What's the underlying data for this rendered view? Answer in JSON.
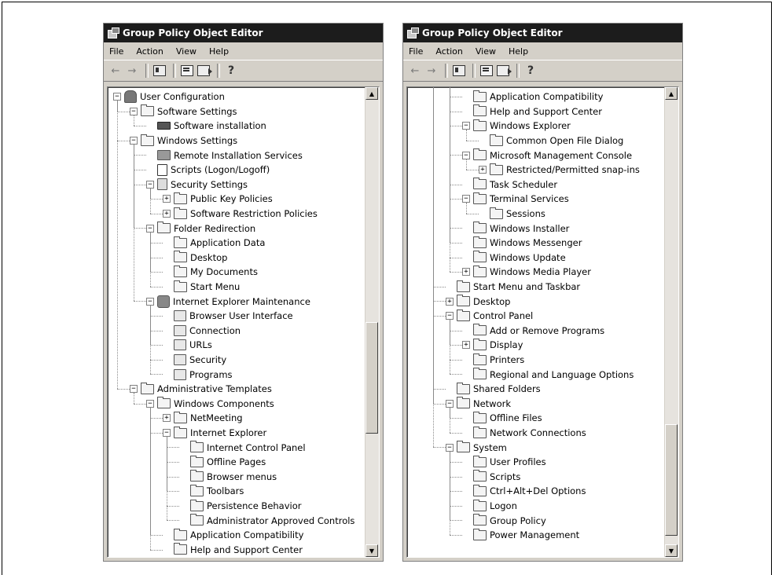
{
  "windows": [
    {
      "title": "Group Policy Object Editor",
      "menu": [
        "File",
        "Action",
        "View",
        "Help"
      ],
      "tree": [
        {
          "label": "User Configuration",
          "level": 0,
          "expander": "minus",
          "icon": "user"
        },
        {
          "label": "Software Settings",
          "level": 1,
          "expander": "minus",
          "icon": "folder"
        },
        {
          "label": "Software installation",
          "level": 2,
          "expander": "none",
          "icon": "drive"
        },
        {
          "label": "Windows Settings",
          "level": 1,
          "expander": "minus",
          "icon": "folder"
        },
        {
          "label": "Remote Installation Services",
          "level": 2,
          "expander": "none",
          "icon": "ris"
        },
        {
          "label": "Scripts (Logon/Logoff)",
          "level": 2,
          "expander": "none",
          "icon": "script"
        },
        {
          "label": "Security Settings",
          "level": 2,
          "expander": "minus",
          "icon": "security"
        },
        {
          "label": "Public Key Policies",
          "level": 3,
          "expander": "plus",
          "icon": "folder"
        },
        {
          "label": "Software Restriction Policies",
          "level": 3,
          "expander": "plus",
          "icon": "folder"
        },
        {
          "label": "Folder Redirection",
          "level": 2,
          "expander": "minus",
          "icon": "folder"
        },
        {
          "label": "Application Data",
          "level": 3,
          "expander": "none",
          "icon": "folder"
        },
        {
          "label": "Desktop",
          "level": 3,
          "expander": "none",
          "icon": "folder"
        },
        {
          "label": "My Documents",
          "level": 3,
          "expander": "none",
          "icon": "folder"
        },
        {
          "label": "Start Menu",
          "level": 3,
          "expander": "none",
          "icon": "folder"
        },
        {
          "label": "Internet Explorer Maintenance",
          "level": 2,
          "expander": "minus",
          "icon": "iem"
        },
        {
          "label": "Browser User Interface",
          "level": 3,
          "expander": "none",
          "icon": "iepage"
        },
        {
          "label": "Connection",
          "level": 3,
          "expander": "none",
          "icon": "iepage"
        },
        {
          "label": "URLs",
          "level": 3,
          "expander": "none",
          "icon": "iepage"
        },
        {
          "label": "Security",
          "level": 3,
          "expander": "none",
          "icon": "iepage"
        },
        {
          "label": "Programs",
          "level": 3,
          "expander": "none",
          "icon": "iepage"
        },
        {
          "label": "Administrative Templates",
          "level": 1,
          "expander": "minus",
          "icon": "folder"
        },
        {
          "label": "Windows Components",
          "level": 2,
          "expander": "minus",
          "icon": "folder"
        },
        {
          "label": "NetMeeting",
          "level": 3,
          "expander": "plus",
          "icon": "folder"
        },
        {
          "label": "Internet Explorer",
          "level": 3,
          "expander": "minus",
          "icon": "folder"
        },
        {
          "label": "Internet Control Panel",
          "level": 4,
          "expander": "none",
          "icon": "folder"
        },
        {
          "label": "Offline Pages",
          "level": 4,
          "expander": "none",
          "icon": "folder"
        },
        {
          "label": "Browser menus",
          "level": 4,
          "expander": "none",
          "icon": "folder"
        },
        {
          "label": "Toolbars",
          "level": 4,
          "expander": "none",
          "icon": "folder"
        },
        {
          "label": "Persistence Behavior",
          "level": 4,
          "expander": "none",
          "icon": "folder"
        },
        {
          "label": "Administrator Approved Controls",
          "level": 4,
          "expander": "none",
          "icon": "folder"
        },
        {
          "label": "Application Compatibility",
          "level": 3,
          "expander": "none",
          "icon": "folder"
        },
        {
          "label": "Help and Support Center",
          "level": 3,
          "expander": "none",
          "icon": "folder"
        }
      ],
      "scroll": {
        "thumb_start": 0.5,
        "thumb_size": 0.25
      }
    },
    {
      "title": "Group Policy Object Editor",
      "menu": [
        "File",
        "Action",
        "View",
        "Help"
      ],
      "tree": [
        {
          "label": "Application Compatibility",
          "level": 3,
          "expander": "none",
          "icon": "folder"
        },
        {
          "label": "Help and Support Center",
          "level": 3,
          "expander": "none",
          "icon": "folder"
        },
        {
          "label": "Windows Explorer",
          "level": 3,
          "expander": "minus",
          "icon": "folder"
        },
        {
          "label": "Common Open File Dialog",
          "level": 4,
          "expander": "none",
          "icon": "folder"
        },
        {
          "label": "Microsoft Management Console",
          "level": 3,
          "expander": "minus",
          "icon": "folder"
        },
        {
          "label": "Restricted/Permitted snap-ins",
          "level": 4,
          "expander": "plus",
          "icon": "folder"
        },
        {
          "label": "Task Scheduler",
          "level": 3,
          "expander": "none",
          "icon": "folder"
        },
        {
          "label": "Terminal Services",
          "level": 3,
          "expander": "minus",
          "icon": "folder"
        },
        {
          "label": "Sessions",
          "level": 4,
          "expander": "none",
          "icon": "folder"
        },
        {
          "label": "Windows Installer",
          "level": 3,
          "expander": "none",
          "icon": "folder"
        },
        {
          "label": "Windows Messenger",
          "level": 3,
          "expander": "none",
          "icon": "folder"
        },
        {
          "label": "Windows Update",
          "level": 3,
          "expander": "none",
          "icon": "folder"
        },
        {
          "label": "Windows Media Player",
          "level": 3,
          "expander": "plus",
          "icon": "folder"
        },
        {
          "label": "Start Menu and Taskbar",
          "level": 2,
          "expander": "none",
          "icon": "folder"
        },
        {
          "label": "Desktop",
          "level": 2,
          "expander": "plus",
          "icon": "folder"
        },
        {
          "label": "Control Panel",
          "level": 2,
          "expander": "minus",
          "icon": "folder"
        },
        {
          "label": "Add or Remove Programs",
          "level": 3,
          "expander": "none",
          "icon": "folder"
        },
        {
          "label": "Display",
          "level": 3,
          "expander": "plus",
          "icon": "folder"
        },
        {
          "label": "Printers",
          "level": 3,
          "expander": "none",
          "icon": "folder"
        },
        {
          "label": "Regional and Language Options",
          "level": 3,
          "expander": "none",
          "icon": "folder"
        },
        {
          "label": "Shared Folders",
          "level": 2,
          "expander": "none",
          "icon": "folder"
        },
        {
          "label": "Network",
          "level": 2,
          "expander": "minus",
          "icon": "folder"
        },
        {
          "label": "Offline Files",
          "level": 3,
          "expander": "none",
          "icon": "folder"
        },
        {
          "label": "Network Connections",
          "level": 3,
          "expander": "none",
          "icon": "folder"
        },
        {
          "label": "System",
          "level": 2,
          "expander": "minus",
          "icon": "folder"
        },
        {
          "label": "User Profiles",
          "level": 3,
          "expander": "none",
          "icon": "folder"
        },
        {
          "label": "Scripts",
          "level": 3,
          "expander": "none",
          "icon": "folder"
        },
        {
          "label": "Ctrl+Alt+Del Options",
          "level": 3,
          "expander": "none",
          "icon": "folder"
        },
        {
          "label": "Logon",
          "level": 3,
          "expander": "none",
          "icon": "folder"
        },
        {
          "label": "Group Policy",
          "level": 3,
          "expander": "none",
          "icon": "folder"
        },
        {
          "label": "Power Management",
          "level": 3,
          "expander": "none",
          "icon": "folder"
        }
      ],
      "scroll": {
        "thumb_start": 0.73,
        "thumb_size": 0.25
      }
    }
  ]
}
